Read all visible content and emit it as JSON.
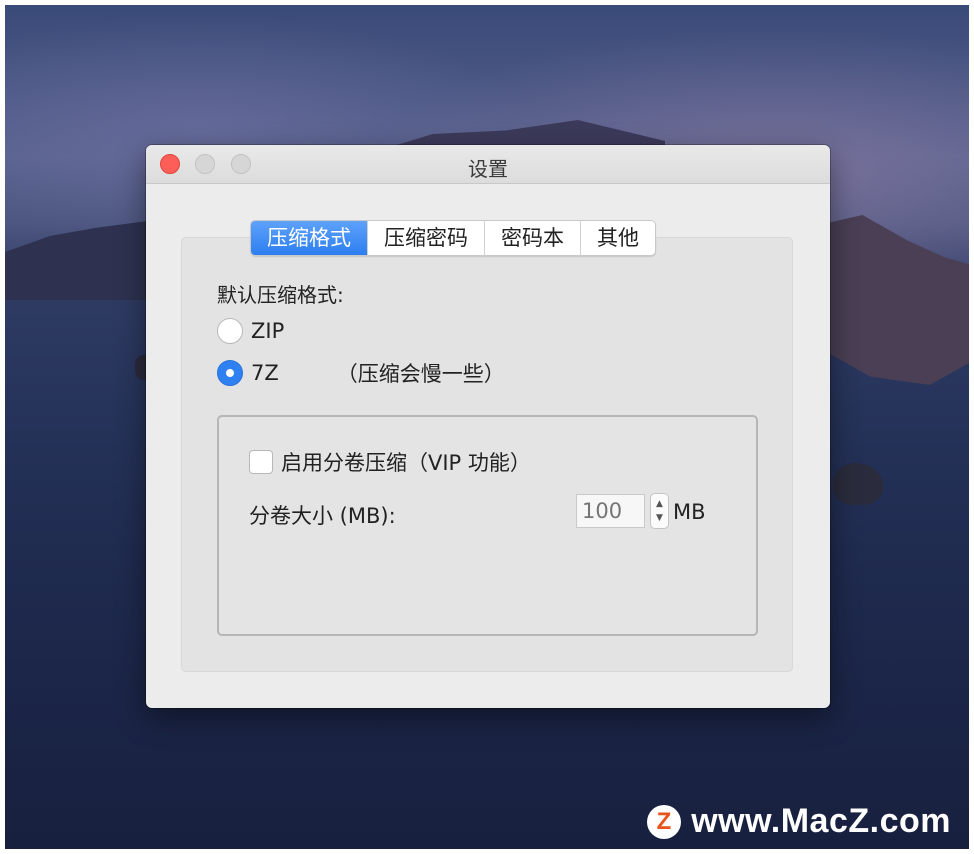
{
  "window": {
    "title": "设置"
  },
  "tabs": [
    "压缩格式",
    "压缩密码",
    "密码本",
    "其他"
  ],
  "active_tab": 0,
  "format": {
    "label": "默认压缩格式:",
    "options": [
      {
        "label": "ZIP",
        "selected": false,
        "note": ""
      },
      {
        "label": "7Z",
        "selected": true,
        "note": "（压缩会慢一些）"
      }
    ]
  },
  "split": {
    "enable_label": "启用分卷压缩（VIP 功能）",
    "enabled": false,
    "size_label": "分卷大小 (MB):",
    "size_placeholder": "100",
    "unit": "MB"
  },
  "watermark": {
    "logo_letter": "Z",
    "text": "www.MacZ.com"
  },
  "colors": {
    "accent": "#2f80f0",
    "close": "#fd5e57"
  }
}
